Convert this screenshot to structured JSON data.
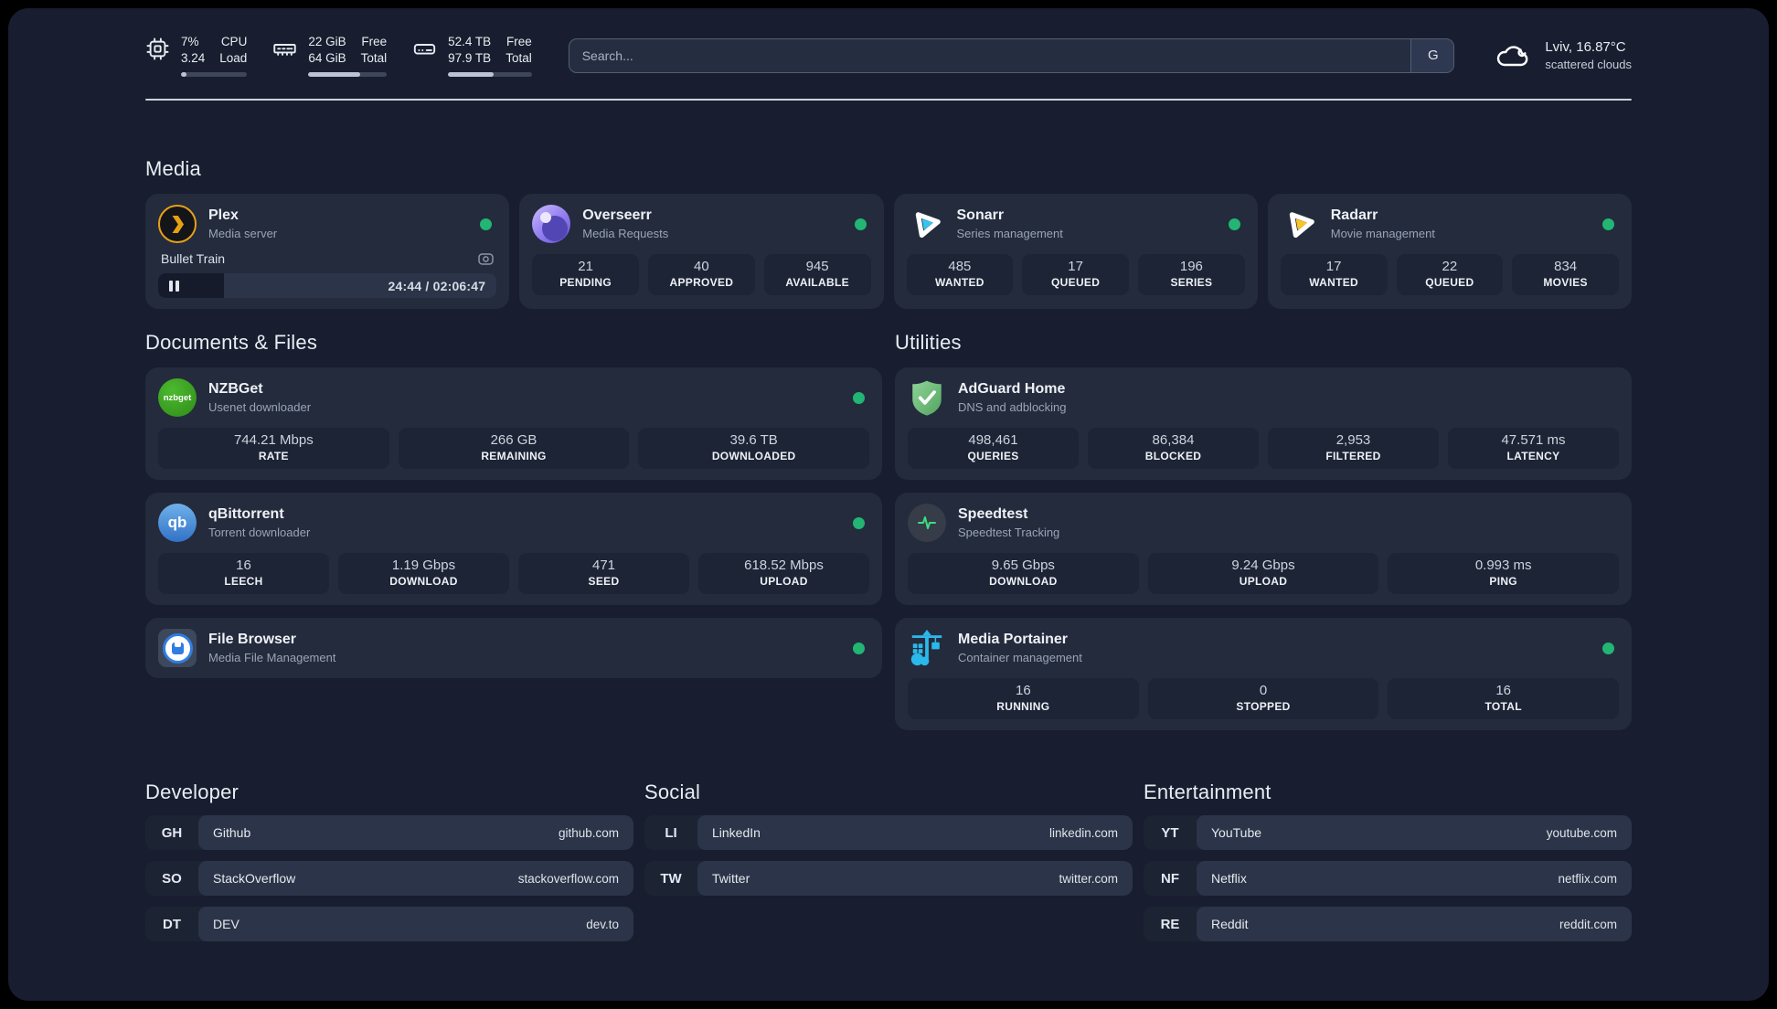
{
  "topbar": {
    "metrics": [
      {
        "id": "cpu",
        "values": [
          "7%",
          "3.24"
        ],
        "labels": [
          "CPU",
          "Load"
        ],
        "bar_percent": 8
      },
      {
        "id": "memory",
        "values": [
          "22 GiB",
          "64 GiB"
        ],
        "labels": [
          "Free",
          "Total"
        ],
        "bar_percent": 66
      },
      {
        "id": "disk",
        "values": [
          "52.4 TB",
          "97.9 TB"
        ],
        "labels": [
          "Free",
          "Total"
        ],
        "bar_percent": 54
      }
    ],
    "search": {
      "placeholder": "Search...",
      "button_label": "G"
    },
    "weather": {
      "location_temp": "Lviv, 16.87°C",
      "condition": "scattered clouds"
    }
  },
  "sections": {
    "media": {
      "title": "Media",
      "plex": {
        "name": "Plex",
        "subtitle": "Media server",
        "online": true,
        "player": {
          "title": "Bullet Train",
          "time": "24:44 / 02:06:47",
          "progress_percent": 19.5,
          "state": "paused"
        }
      },
      "overseerr": {
        "name": "Overseerr",
        "subtitle": "Media Requests",
        "online": true,
        "stats": [
          {
            "value": "21",
            "label": "PENDING"
          },
          {
            "value": "40",
            "label": "APPROVED"
          },
          {
            "value": "945",
            "label": "AVAILABLE"
          }
        ]
      },
      "sonarr": {
        "name": "Sonarr",
        "subtitle": "Series management",
        "online": true,
        "stats": [
          {
            "value": "485",
            "label": "WANTED"
          },
          {
            "value": "17",
            "label": "QUEUED"
          },
          {
            "value": "196",
            "label": "SERIES"
          }
        ]
      },
      "radarr": {
        "name": "Radarr",
        "subtitle": "Movie management",
        "online": true,
        "stats": [
          {
            "value": "17",
            "label": "WANTED"
          },
          {
            "value": "22",
            "label": "QUEUED"
          },
          {
            "value": "834",
            "label": "MOVIES"
          }
        ]
      }
    },
    "documents": {
      "title": "Documents & Files",
      "nzbget": {
        "name": "NZBGet",
        "subtitle": "Usenet downloader",
        "online": true,
        "stats": [
          {
            "value": "744.21 Mbps",
            "label": "RATE"
          },
          {
            "value": "266 GB",
            "label": "REMAINING"
          },
          {
            "value": "39.6 TB",
            "label": "DOWNLOADED"
          }
        ]
      },
      "qbittorrent": {
        "name": "qBittorrent",
        "subtitle": "Torrent downloader",
        "online": true,
        "stats": [
          {
            "value": "16",
            "label": "LEECH"
          },
          {
            "value": "1.19 Gbps",
            "label": "DOWNLOAD"
          },
          {
            "value": "471",
            "label": "SEED"
          },
          {
            "value": "618.52 Mbps",
            "label": "UPLOAD"
          }
        ]
      },
      "filebrowser": {
        "name": "File Browser",
        "subtitle": "Media File Management",
        "online": true
      }
    },
    "utilities": {
      "title": "Utilities",
      "adguard": {
        "name": "AdGuard Home",
        "subtitle": "DNS and adblocking",
        "stats": [
          {
            "value": "498,461",
            "label": "QUERIES"
          },
          {
            "value": "86,384",
            "label": "BLOCKED"
          },
          {
            "value": "2,953",
            "label": "FILTERED"
          },
          {
            "value": "47.571 ms",
            "label": "LATENCY"
          }
        ]
      },
      "speedtest": {
        "name": "Speedtest",
        "subtitle": "Speedtest Tracking",
        "stats": [
          {
            "value": "9.65 Gbps",
            "label": "DOWNLOAD"
          },
          {
            "value": "9.24 Gbps",
            "label": "UPLOAD"
          },
          {
            "value": "0.993 ms",
            "label": "PING"
          }
        ]
      },
      "portainer": {
        "name": "Media Portainer",
        "subtitle": "Container management",
        "online": true,
        "stats": [
          {
            "value": "16",
            "label": "RUNNING"
          },
          {
            "value": "0",
            "label": "STOPPED"
          },
          {
            "value": "16",
            "label": "TOTAL"
          }
        ]
      }
    }
  },
  "bookmarks": {
    "developer": {
      "title": "Developer",
      "items": [
        {
          "abbr": "GH",
          "name": "Github",
          "url": "github.com"
        },
        {
          "abbr": "SO",
          "name": "StackOverflow",
          "url": "stackoverflow.com"
        },
        {
          "abbr": "DT",
          "name": "DEV",
          "url": "dev.to"
        }
      ]
    },
    "social": {
      "title": "Social",
      "items": [
        {
          "abbr": "LI",
          "name": "LinkedIn",
          "url": "linkedin.com"
        },
        {
          "abbr": "TW",
          "name": "Twitter",
          "url": "twitter.com"
        }
      ]
    },
    "entertainment": {
      "title": "Entertainment",
      "items": [
        {
          "abbr": "YT",
          "name": "YouTube",
          "url": "youtube.com"
        },
        {
          "abbr": "NF",
          "name": "Netflix",
          "url": "netflix.com"
        },
        {
          "abbr": "RE",
          "name": "Reddit",
          "url": "reddit.com"
        }
      ]
    }
  },
  "icons": {
    "nzbget_text": "nzbget",
    "qbittorrent_text": "qb"
  },
  "colors": {
    "status_online": "#22b573",
    "page_bg": "#181e2f",
    "card_bg": "#232b3d",
    "plex_amber": "#e7a015",
    "sonarr_cyan": "#36c3f2",
    "radarr_yellow": "#fbc524",
    "nzbget_green": "#38a51f",
    "qbittorrent_blue": "#3b7fd0",
    "adguard_green": "#63b168",
    "speedtest_green": "#3ddc84",
    "portainer_blue": "#2bb8ea"
  }
}
